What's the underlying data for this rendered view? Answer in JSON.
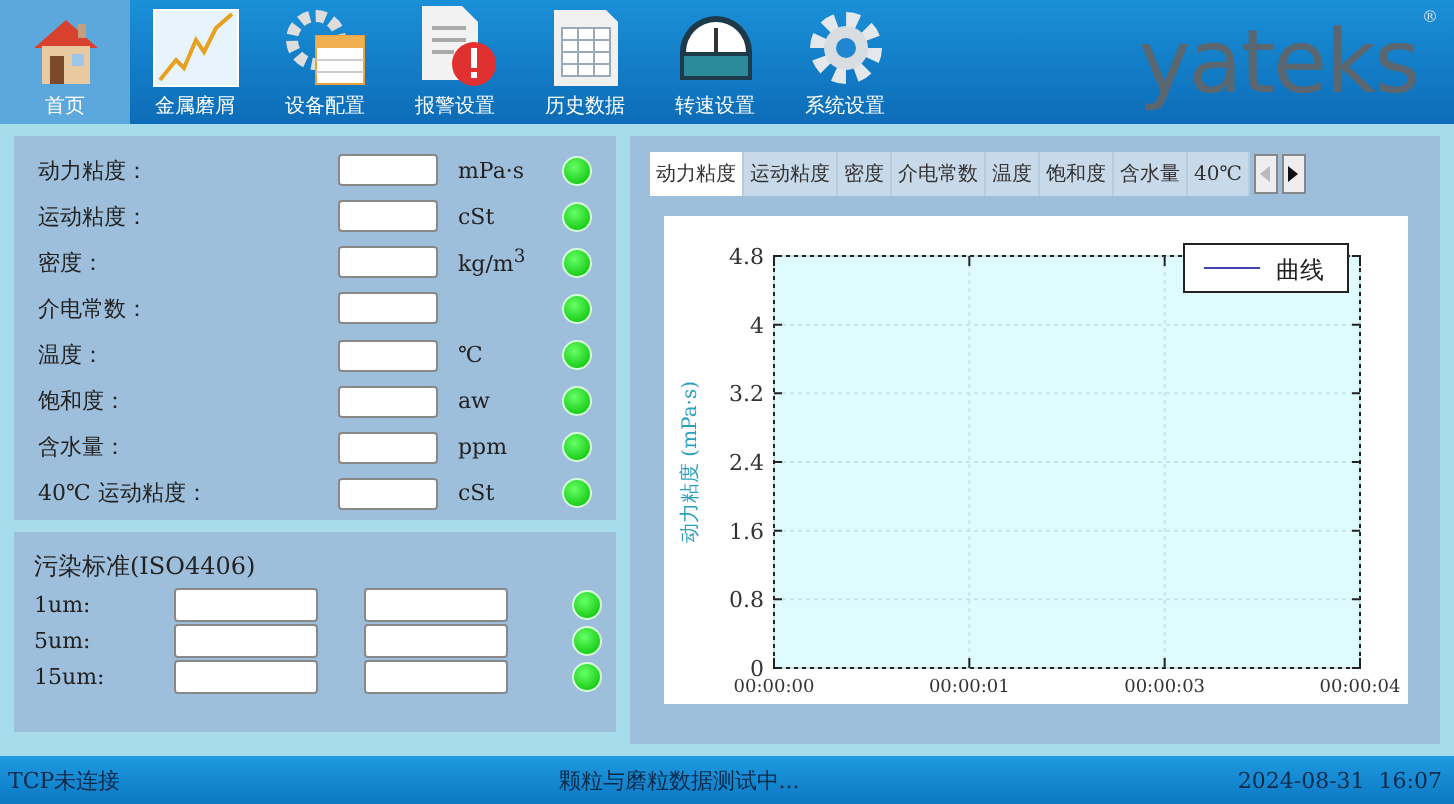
{
  "toolbar": {
    "items": [
      {
        "label": "首页",
        "selected": true
      },
      {
        "label": "金属磨屑",
        "selected": false
      },
      {
        "label": "设备配置",
        "selected": false
      },
      {
        "label": "报警设置",
        "selected": false
      },
      {
        "label": "历史数据",
        "selected": false
      },
      {
        "label": "转速设置",
        "selected": false
      },
      {
        "label": "系统设置",
        "selected": false
      }
    ],
    "logo": "yateks",
    "logo_mark": "®"
  },
  "measurements": [
    {
      "label": "动力粘度：",
      "unit": "mPa·s",
      "on": true
    },
    {
      "label": "运动粘度：",
      "unit": "cSt",
      "on": true
    },
    {
      "label": "密度：",
      "unit": "kg/m$^{3}$",
      "on": true
    },
    {
      "label": "介电常数：",
      "on": true
    },
    {
      "label": "温度：",
      "unit": "℃",
      "on": true
    },
    {
      "label": "饱和度：",
      "unit": "aw",
      "on": true
    },
    {
      "label": "含水量：",
      "unit": "ppm",
      "on": true
    },
    {
      "label": "40℃ 运动粘度：",
      "unit": "cSt",
      "on": true
    }
  ],
  "contamination": {
    "title": "污染标准(ISO4406)",
    "rows": [
      {
        "label": "1um:",
        "on": true
      },
      {
        "label": "5um:",
        "on": true
      },
      {
        "label": "15um:",
        "on": true
      }
    ]
  },
  "chart_tabs": [
    {
      "label": "动力粘度",
      "selected": true
    },
    {
      "label": "运动粘度",
      "selected": false
    },
    {
      "label": "密度",
      "selected": false
    },
    {
      "label": "介电常数",
      "selected": false
    },
    {
      "label": "温度",
      "selected": false
    },
    {
      "label": "饱和度",
      "selected": false
    },
    {
      "label": "含水量",
      "selected": false
    },
    {
      "label": "40℃",
      "selected": false
    }
  ],
  "chart_data": {
    "type": "line",
    "ylabel": "动力粘度 (mPa·s)",
    "categories": [
      "00:00:00",
      "00:00:01",
      "00:00:03",
      "00:00:04"
    ],
    "series": [
      {
        "name": "曲线",
        "color": "#4040b0",
        "values": [
          null,
          null,
          null,
          null
        ]
      }
    ],
    "ylim": [
      0,
      4.8
    ],
    "grid": true,
    "yticks": [
      0,
      0.8,
      1.6,
      2.4,
      3.2,
      4,
      4.8
    ]
  },
  "status_bar": {
    "connection": "TCP未连接",
    "message": "颗粒与磨粒数据测试中...",
    "datetime": "2024-08-31  16:07"
  }
}
